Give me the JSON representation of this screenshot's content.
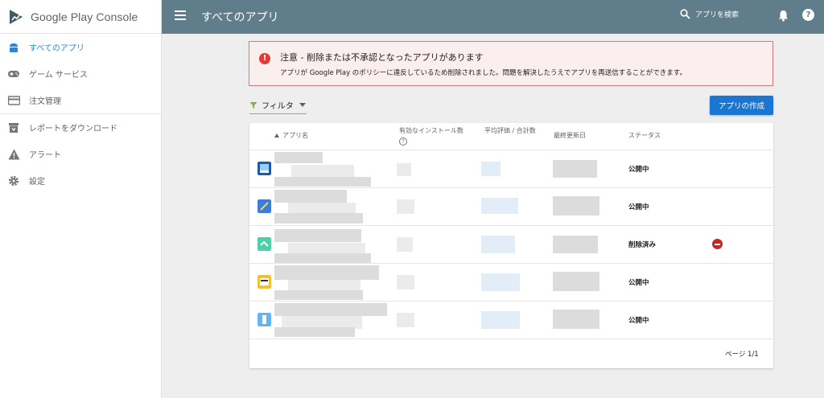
{
  "brand": {
    "name": "Google Play Console",
    "icon": "play-console-logo"
  },
  "sidebar": {
    "items": [
      {
        "label": "すべてのアプリ",
        "icon": "android-icon",
        "active": true
      },
      {
        "label": "ゲーム サービス",
        "icon": "gamepad-icon"
      },
      {
        "label": "注文管理",
        "icon": "credit-card-icon"
      },
      {
        "label": "レポートをダウンロード",
        "icon": "download-box-icon"
      },
      {
        "label": "アラート",
        "icon": "warning-icon"
      },
      {
        "label": "設定",
        "icon": "gear-icon"
      }
    ]
  },
  "header": {
    "title": "すべてのアプリ",
    "search_label": "アプリを検索",
    "help": "?"
  },
  "alert": {
    "icon": "!",
    "title": "注意 - 削除または不承認となったアプリがあります",
    "body": "アプリが Google Play のポリシーに違反しているため削除されました。問題を解決したうえでアプリを再送信することができます。"
  },
  "filter": {
    "label": "フィルタ"
  },
  "create_button": {
    "label": "アプリの作成"
  },
  "table": {
    "columns": {
      "name": "アプリ名",
      "installs": "有効なインストール数",
      "rating": "平均評価 / 合計数",
      "updated": "最終更新日",
      "status": "ステータス"
    },
    "help_icon": "?",
    "rows": [
      {
        "status": "公開中"
      },
      {
        "status": "公開中"
      },
      {
        "status": "削除済み",
        "removed": true
      },
      {
        "status": "公開中"
      },
      {
        "status": "公開中"
      }
    ]
  },
  "pager": {
    "label": "ページ 1/1"
  },
  "colors": {
    "header": "#607d8b",
    "accent": "#1976d2",
    "alert_border": "#e57373",
    "alert_bg": "#fbeeee",
    "removed": "#c62828"
  }
}
